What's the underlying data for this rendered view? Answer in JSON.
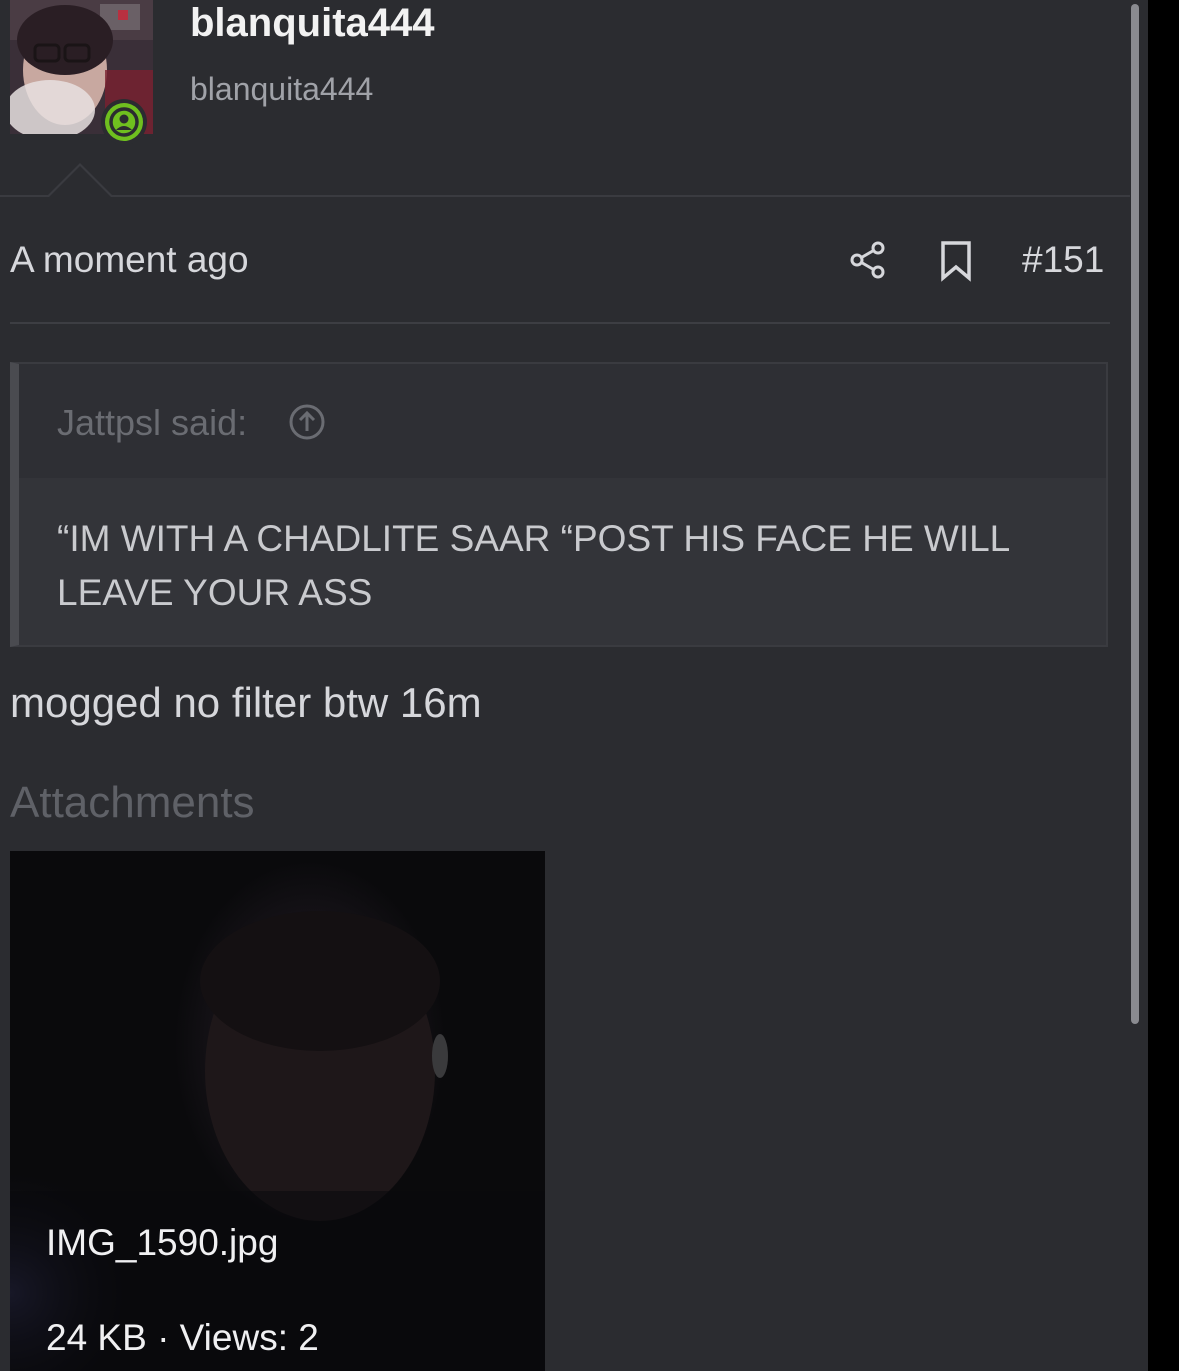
{
  "user": {
    "username": "blanquita444",
    "title": "blanquita444",
    "avatar_icon": "user-avatar-photo",
    "status_icon": "online-person-icon",
    "status_color": "#6fbf1f"
  },
  "post": {
    "timestamp": "A moment ago",
    "share_icon": "share-icon",
    "bookmark_icon": "bookmark-icon",
    "number": "#151"
  },
  "quote": {
    "author": "Jattpsl said:",
    "jump_icon": "arrow-up-circle-icon",
    "text": "“IM WITH A CHADLITE SAAR “POST HIS FACE HE WILL LEAVE YOUR ASS"
  },
  "message": {
    "text": "mogged no filter btw 16m"
  },
  "attachments": {
    "title": "Attachments",
    "items": [
      {
        "filename": "IMG_1590.jpg",
        "meta": "24 KB · Views: 2"
      }
    ]
  },
  "colors": {
    "background": "#2b2c30",
    "text": "#d6d7db",
    "muted": "#5f6167",
    "accent_online": "#6fbf1f"
  }
}
